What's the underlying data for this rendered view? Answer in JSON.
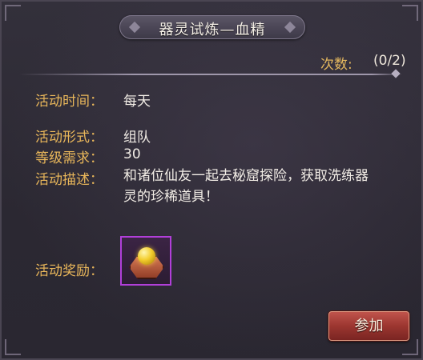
{
  "dialog": {
    "title": "器灵试炼—血精",
    "count_label": "次数:",
    "count_value": "(0/2)"
  },
  "details": {
    "time_label": "活动时间：",
    "time_value": "每天",
    "form_label": "活动形式：",
    "form_value": "组队",
    "level_label": "等级需求：",
    "level_value": "30",
    "desc_label": "活动描述：",
    "desc_value": "和诸位仙友一起去秘窟探险，获取洗练器灵的珍稀道具！",
    "reward_label": "活动奖励："
  },
  "reward": {
    "icon": "golden-orb-pedestal-icon",
    "rarity_color": "#b13fd9"
  },
  "actions": {
    "join_label": "参加"
  },
  "colors": {
    "label": "#e8b65a",
    "value": "#f2ede6",
    "button": "#9c3630"
  }
}
